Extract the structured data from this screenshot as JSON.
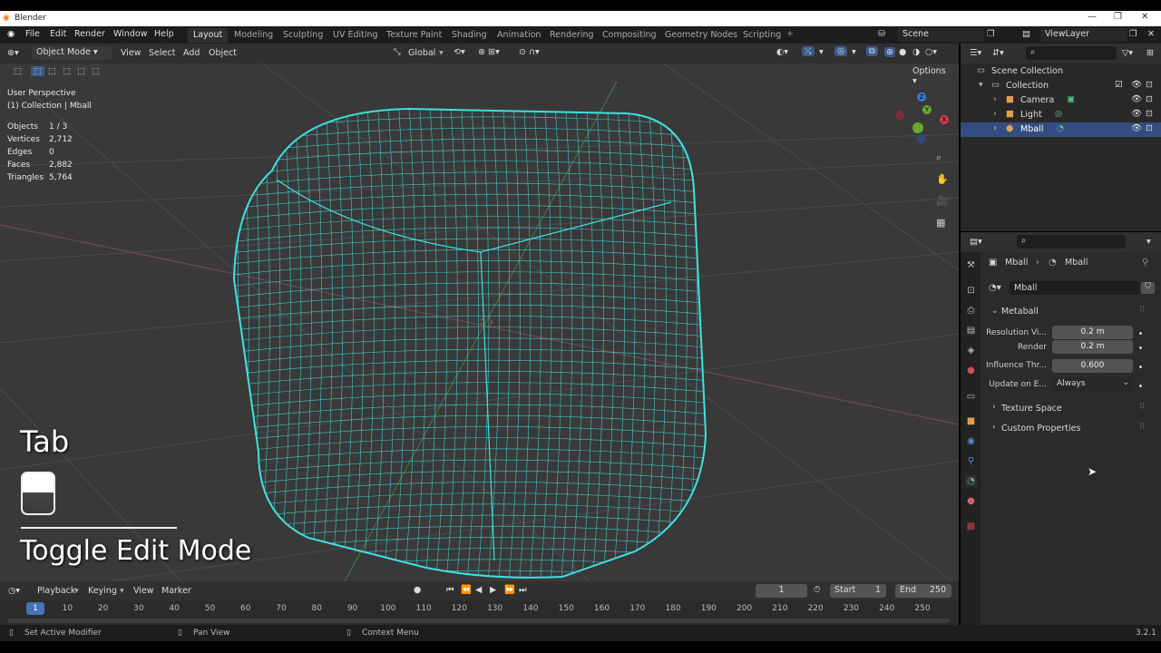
{
  "window": {
    "title": "Blender"
  },
  "topbar": {
    "menus": [
      "File",
      "Edit",
      "Render",
      "Window",
      "Help"
    ],
    "workspaces": [
      "Layout",
      "Modeling",
      "Sculpting",
      "UV Editing",
      "Texture Paint",
      "Shading",
      "Animation",
      "Rendering",
      "Compositing",
      "Geometry Nodes",
      "Scripting"
    ],
    "scene": "Scene",
    "view_layer": "ViewLayer"
  },
  "viewport": {
    "mode": "Object Mode",
    "menus": [
      "View",
      "Select",
      "Add",
      "Object"
    ],
    "orientation": "Global",
    "options": "Options",
    "perspective": "User Perspective",
    "context": "(1) Collection | Mball",
    "stats": [
      {
        "label": "Objects",
        "value": "1 / 3"
      },
      {
        "label": "Vertices",
        "value": "2,712"
      },
      {
        "label": "Edges",
        "value": "0"
      },
      {
        "label": "Faces",
        "value": "2,882"
      },
      {
        "label": "Triangles",
        "value": "5,764"
      }
    ],
    "gizmo_axes": [
      "Z",
      "Y",
      "X"
    ]
  },
  "overlay": {
    "key": "Tab",
    "action": "Toggle Edit Mode"
  },
  "outliner": {
    "items": [
      {
        "label": "Scene Collection"
      },
      {
        "label": "Collection"
      },
      {
        "label": "Camera"
      },
      {
        "label": "Light"
      },
      {
        "label": "Mball"
      }
    ]
  },
  "properties": {
    "breadcrumb": [
      "Mball",
      "Mball"
    ],
    "datablock": "Mball",
    "panel": "Metaball",
    "fields": [
      {
        "label": "Resolution Vi...",
        "value": "0.2 m"
      },
      {
        "label": "Render",
        "value": "0.2 m"
      },
      {
        "label": "Influence Thr...",
        "value": "0.600"
      },
      {
        "label": "Update on E...",
        "value": "Always"
      }
    ],
    "subpanels": [
      "Texture Space",
      "Custom Properties"
    ]
  },
  "timeline": {
    "menus": [
      "Playback",
      "Keying",
      "View",
      "Marker"
    ],
    "current_frame": "1",
    "start_label": "Start",
    "start": "1",
    "end_label": "End",
    "end": "250",
    "ticks": [
      "1",
      "10",
      "20",
      "30",
      "40",
      "50",
      "60",
      "70",
      "80",
      "90",
      "100",
      "110",
      "120",
      "130",
      "140",
      "150",
      "160",
      "170",
      "180",
      "190",
      "200",
      "210",
      "220",
      "230",
      "240",
      "250"
    ]
  },
  "statusbar": {
    "items": [
      "Set Active Modifier",
      "Pan View",
      "Context Menu"
    ],
    "version": "3.2.1"
  },
  "colors": {
    "wire": "#3fe0e0",
    "selected_row": "#334d80",
    "accent": "#4772b3"
  }
}
